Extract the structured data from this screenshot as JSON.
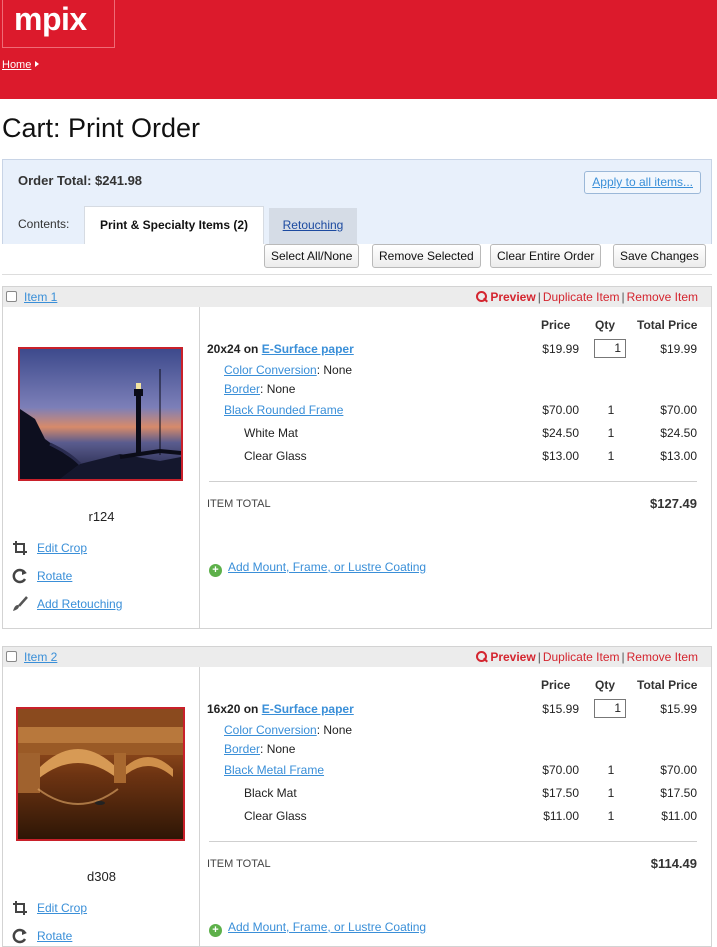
{
  "header": {
    "logo": "mpix",
    "breadcrumb": {
      "home": "Home"
    }
  },
  "page": {
    "title": "Cart: Print Order"
  },
  "order": {
    "total_label": "Order Total: $241.98",
    "apply_all": "Apply to all items...",
    "contents_label": "Contents:",
    "tabs": [
      {
        "label": "Print & Specialty Items (2)",
        "active": true
      },
      {
        "label": "Retouching",
        "active": false
      }
    ],
    "toolbar": {
      "select_all": "Select All/None",
      "remove_selected": "Remove Selected",
      "clear_order": "Clear Entire Order",
      "save_changes": "Save Changes"
    }
  },
  "columns": {
    "price": "Price",
    "qty": "Qty",
    "total_price": "Total Price"
  },
  "common": {
    "preview": "Preview",
    "duplicate": "Duplicate Item",
    "remove": "Remove Item",
    "edit_crop": "Edit Crop",
    "rotate": "Rotate",
    "add_retouching": "Add Retouching",
    "item_total_label": "ITEM TOTAL",
    "add_mount": "Add Mount, Frame, or Lustre Coating",
    "color_conversion_label": "Color Conversion",
    "border_label": "Border",
    "separator": "|"
  },
  "items": [
    {
      "label": "Item 1",
      "photo_id": "r124",
      "size_prefix": "20x24 on",
      "paper": "E-Surface paper",
      "price": "$19.99",
      "qty": "1",
      "total": "$19.99",
      "color_conversion_value": ": None",
      "border_value": ": None",
      "frame": {
        "name": "Black Rounded Frame",
        "price": "$70.00",
        "qty": "1",
        "total": "$70.00"
      },
      "mat": {
        "name": "White Mat",
        "price": "$24.50",
        "qty": "1",
        "total": "$24.50"
      },
      "glass": {
        "name": "Clear Glass",
        "price": "$13.00",
        "qty": "1",
        "total": "$13.00"
      },
      "item_total": "$127.49"
    },
    {
      "label": "Item 2",
      "photo_id": "d308",
      "size_prefix": "16x20 on",
      "paper": "E-Surface paper",
      "price": "$15.99",
      "qty": "1",
      "total": "$15.99",
      "color_conversion_value": ": None",
      "border_value": ": None",
      "frame": {
        "name": "Black Metal Frame",
        "price": "$70.00",
        "qty": "1",
        "total": "$70.00"
      },
      "mat": {
        "name": "Black Mat",
        "price": "$17.50",
        "qty": "1",
        "total": "$17.50"
      },
      "glass": {
        "name": "Clear Glass",
        "price": "$11.00",
        "qty": "1",
        "total": "$11.00"
      },
      "item_total": "$114.49"
    }
  ]
}
